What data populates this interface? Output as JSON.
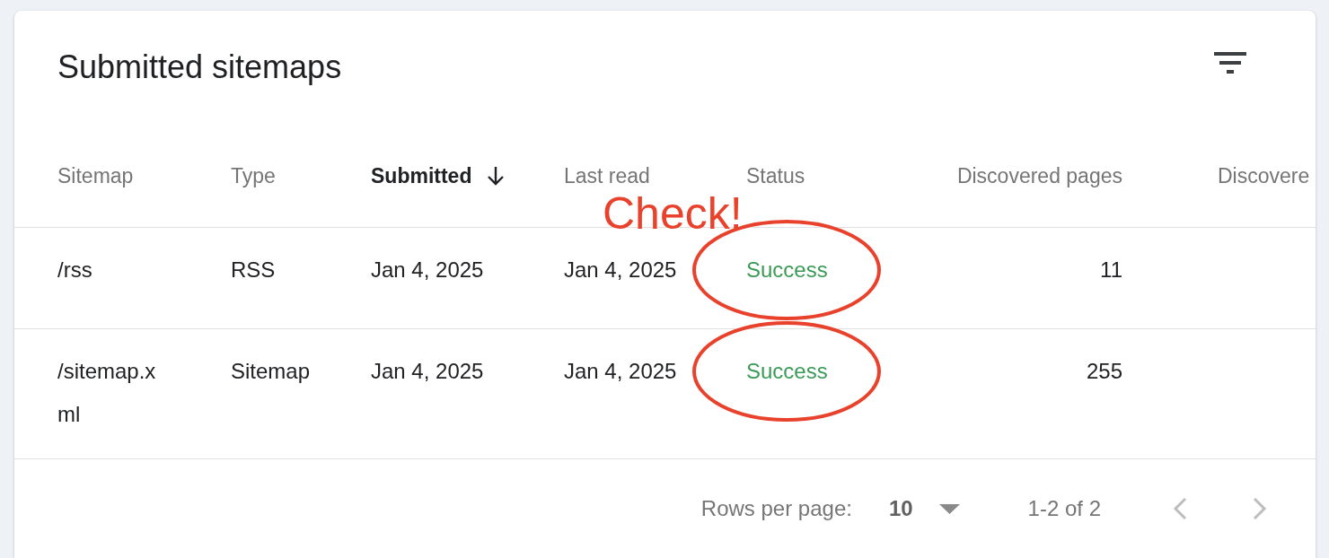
{
  "card": {
    "title": "Submitted sitemaps"
  },
  "table": {
    "columns": [
      {
        "label": "Sitemap",
        "kind": "text",
        "sorted": false
      },
      {
        "label": "Type",
        "kind": "text",
        "sorted": false
      },
      {
        "label": "Submitted",
        "kind": "text",
        "sorted": true
      },
      {
        "label": "Last read",
        "kind": "text",
        "sorted": false
      },
      {
        "label": "Status",
        "kind": "status",
        "sorted": false
      },
      {
        "label": "Discovered pages",
        "kind": "number",
        "sorted": false
      },
      {
        "label": "Discovere",
        "kind": "text",
        "sorted": false
      }
    ],
    "rows": [
      {
        "cells": [
          "/rss",
          "RSS",
          "Jan 4, 2025",
          "Jan 4, 2025",
          "Success",
          "11"
        ],
        "succeeded": true,
        "circled": true
      },
      {
        "cells": [
          "/sitemap.xml",
          "Sitemap",
          "Jan 4, 2025",
          "Jan 4, 2025",
          "Success",
          "255"
        ],
        "succeeded": true,
        "circled": true
      }
    ]
  },
  "pagination": {
    "rows_per_page_label": "Rows per page:",
    "rows_per_page": "10",
    "range": "1-2 of 2",
    "previous_disabled": true,
    "next_disabled": true
  },
  "annotation": {
    "text": "Check!"
  }
}
